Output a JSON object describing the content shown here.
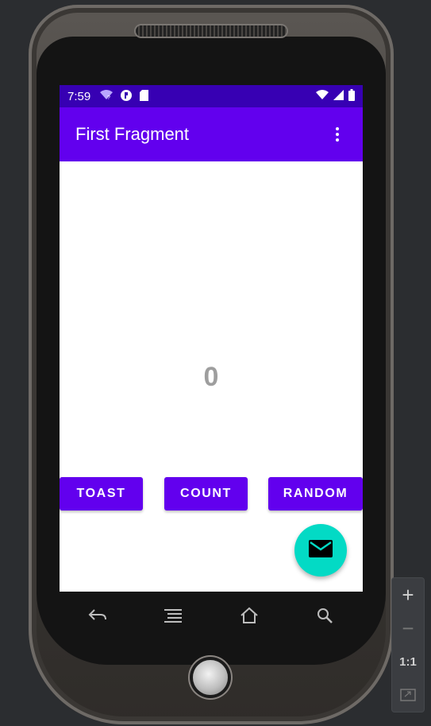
{
  "status_bar": {
    "time": "7:59",
    "left_icons": [
      "wifi-question-icon",
      "sync-icon",
      "sd-card-icon"
    ],
    "right_icons": [
      "wifi-icon",
      "cell-signal-icon",
      "battery-icon"
    ]
  },
  "app_bar": {
    "title": "First Fragment",
    "overflow_icon": "more-vert-icon"
  },
  "main": {
    "count_value": "0"
  },
  "buttons": {
    "toast": "TOAST",
    "count": "COUNT",
    "random": "RANDOM"
  },
  "fab": {
    "icon": "email-icon"
  },
  "nav": {
    "icons": [
      "back-icon",
      "menu-icon",
      "home-icon",
      "search-icon"
    ]
  },
  "zoom_controls": {
    "zoom_in": "+",
    "zoom_out": "−",
    "actual_size": "1:1",
    "fit_icon": "fit-screen-icon"
  },
  "colors": {
    "primary": "#6200ee",
    "primary_dark": "#3700b3",
    "secondary": "#03dac5",
    "count_text": "#9e9e9e"
  }
}
